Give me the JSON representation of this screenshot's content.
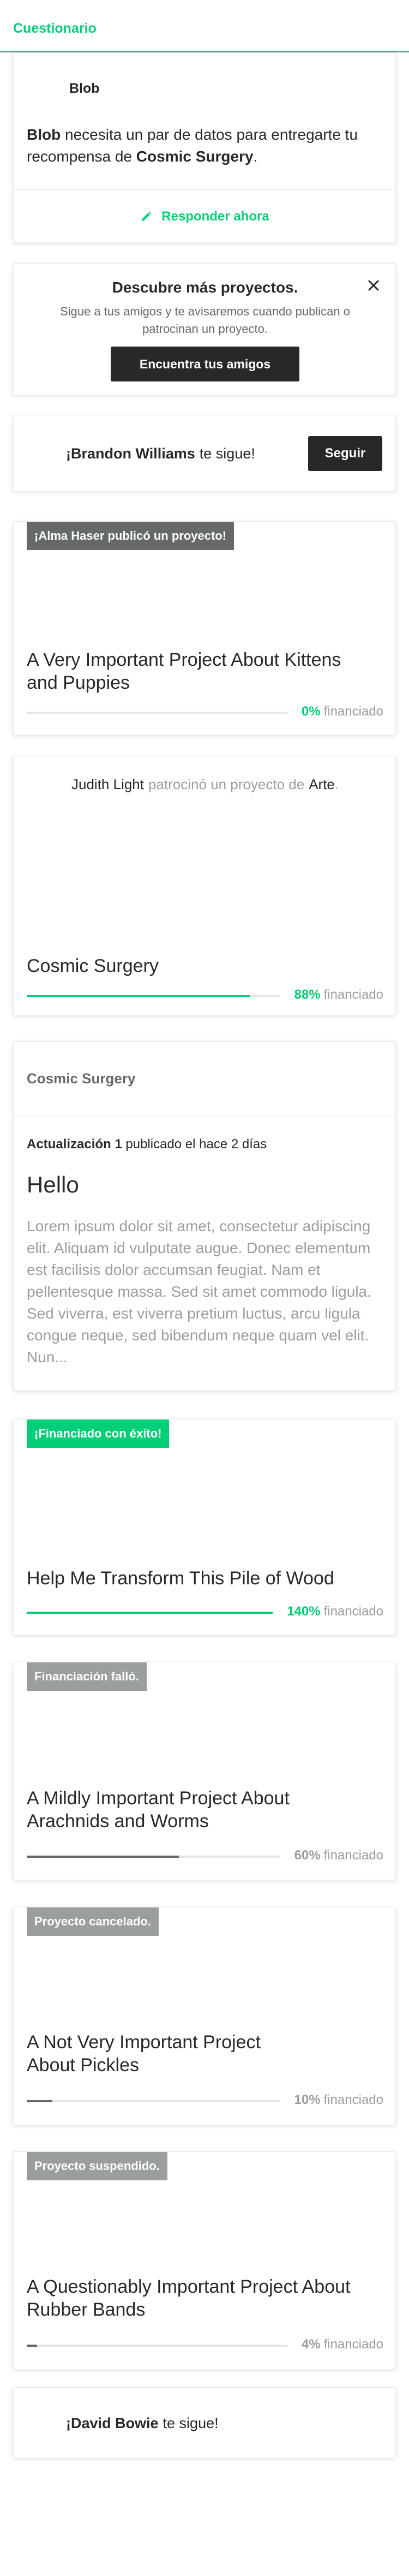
{
  "survey": {
    "header_title": "Cuestionario",
    "creator_name": "Blob",
    "message_creator": "Blob",
    "message_mid": "necesita un par de datos para entregarte tu recompensa de",
    "message_project": "Cosmic Surgery",
    "message_end": ".",
    "action_label": "Responder ahora"
  },
  "discover": {
    "title": "Descubre más proyectos.",
    "subtitle": "Sigue a tus amigos y te avisaremos cuando publican o patrocinan un proyecto.",
    "button_label": "Encuentra tus amigos"
  },
  "follow1": {
    "name": "¡Brandon Williams",
    "text": "te sigue!",
    "button_label": "Seguir"
  },
  "project1": {
    "badge": "¡Alma Haser publicó un proyecto!",
    "title": "A Very Important Project About Kittens and Puppies",
    "percent": 0,
    "percent_label": "0%",
    "funded_label": "financiado",
    "color": "#05ce78"
  },
  "project2": {
    "sponsor_name": "Judith Light",
    "sponsor_text": "patrocinó un proyecto de",
    "category": "Arte",
    "period": ".",
    "title": "Cosmic Surgery",
    "percent": 88,
    "percent_label": "88%",
    "funded_label": "financiado",
    "color": "#05ce78"
  },
  "update": {
    "project_name": "Cosmic Surgery",
    "update_label": "Actualización 1",
    "posted_text": "publicado el hace 2 días",
    "title": "Hello",
    "body": "Lorem ipsum dolor sit amet, consectetur adipiscing elit. Aliquam id vulputate augue. Donec elementum est facilisis dolor accumsan feugiat. Nam et pellentesque massa. Sed sit amet commodo ligula. Sed viverra, est viverra pretium luctus, arcu ligula congue neque, sed bibendum neque quam vel elit. Nun..."
  },
  "project3": {
    "badge": "¡Financiado con éxito!",
    "title": "Help Me Transform This Pile of Wood",
    "percent": 140,
    "percent_label": "140%",
    "funded_label": "financiado",
    "color": "#05ce78"
  },
  "project4": {
    "badge": "Financiación falló.",
    "title": "A Mildly Important Project About Arachnids and Worms",
    "percent": 60,
    "percent_label": "60%",
    "funded_label": "financiado",
    "color": "#656969"
  },
  "project5": {
    "badge": "Proyecto cancelado.",
    "title": "A Not Very Important Project About Pickles",
    "percent": 10,
    "percent_label": "10%",
    "funded_label": "financiado",
    "color": "#656969"
  },
  "project6": {
    "badge": "Proyecto suspendido.",
    "title": "A Questionably Important Project About Rubber Bands",
    "percent": 4,
    "percent_label": "4%",
    "funded_label": "financiado",
    "color": "#656969"
  },
  "follow2": {
    "name": "¡David Bowie",
    "text": "te sigue!"
  }
}
